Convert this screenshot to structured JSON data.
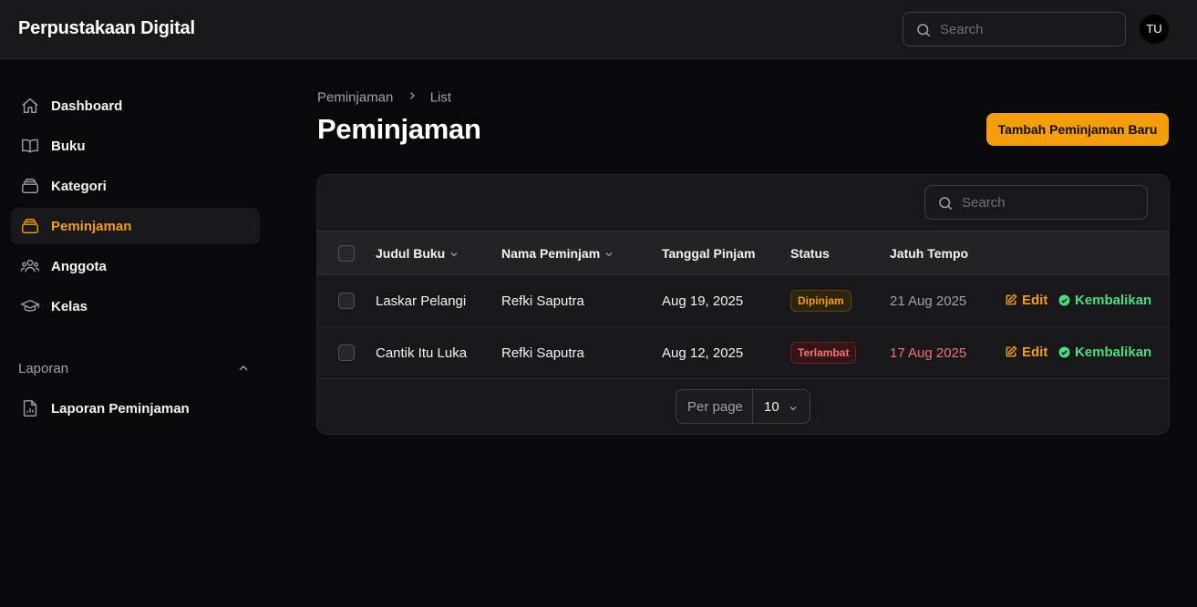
{
  "app": {
    "brand": "Perpustakaan Digital",
    "user_initials": "TU",
    "accent": "#f59e0b"
  },
  "topbar": {
    "search_placeholder": "Search"
  },
  "sidebar": {
    "items": [
      {
        "label": "Dashboard",
        "icon": "home-icon",
        "active": false
      },
      {
        "label": "Buku",
        "icon": "book-open-icon",
        "active": false
      },
      {
        "label": "Kategori",
        "icon": "rectangle-stack-icon",
        "active": false
      },
      {
        "label": "Peminjaman",
        "icon": "rectangle-stack-icon",
        "active": true
      },
      {
        "label": "Anggota",
        "icon": "user-group-icon",
        "active": false
      },
      {
        "label": "Kelas",
        "icon": "academic-cap-icon",
        "active": false
      }
    ],
    "groups": [
      {
        "label": "Laporan",
        "items": [
          {
            "label": "Laporan Peminjaman",
            "icon": "document-chart-icon"
          }
        ]
      }
    ]
  },
  "breadcrumb": [
    "Peminjaman",
    "List"
  ],
  "page": {
    "title": "Peminjaman",
    "primary_action": "Tambah Peminjaman Baru"
  },
  "table": {
    "search_placeholder": "Search",
    "columns": [
      "Judul Buku",
      "Nama Peminjam",
      "Tanggal Pinjam",
      "Status",
      "Jatuh Tempo"
    ],
    "rows": [
      {
        "judul": "Laskar Pelangi",
        "peminjam": "Refki Saputra",
        "tanggal": "Aug 19, 2025",
        "status": "Dipinjam",
        "jatuh_tempo": "21 Aug 2025",
        "edit": "Edit",
        "kembalikan": "Kembalikan"
      },
      {
        "judul": "Cantik Itu Luka",
        "peminjam": "Refki Saputra",
        "tanggal": "Aug 12, 2025",
        "status": "Terlambat",
        "jatuh_tempo": "17 Aug 2025",
        "edit": "Edit",
        "kembalikan": "Kembalikan"
      }
    ],
    "pagination": {
      "per_page_label": "Per page",
      "per_page_value": "10"
    }
  }
}
